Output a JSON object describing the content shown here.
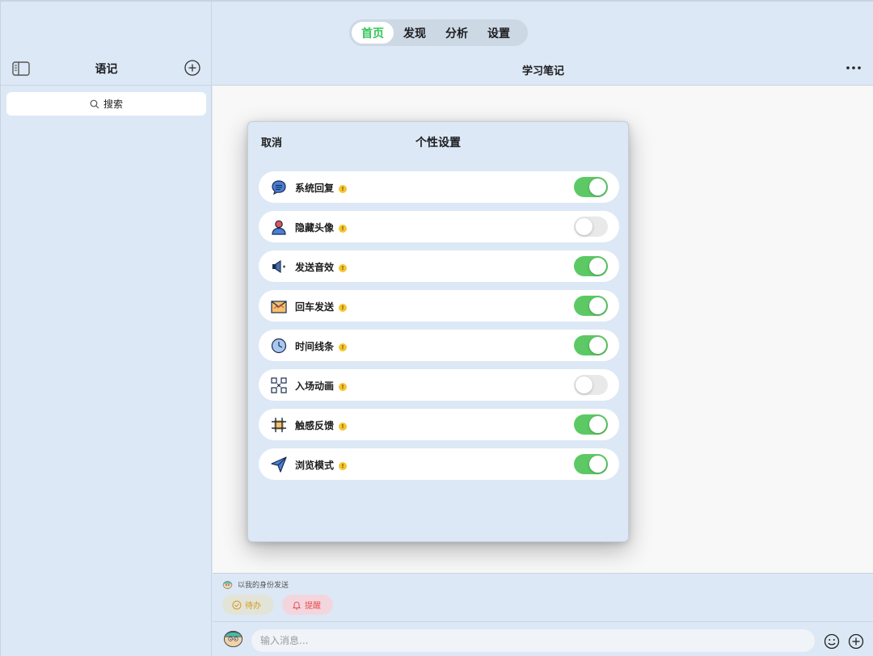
{
  "tabs": [
    {
      "label": "首页",
      "active": true
    },
    {
      "label": "发现",
      "active": false
    },
    {
      "label": "分析",
      "active": false
    },
    {
      "label": "设置",
      "active": false
    }
  ],
  "sidebar": {
    "title": "语记",
    "search_label": "搜索"
  },
  "main": {
    "title": "学习笔记"
  },
  "modal": {
    "cancel_label": "取消",
    "title": "个性设置",
    "info_glyph": "!",
    "settings": [
      {
        "label": "系统回复",
        "icon": "chat-bubble-icon",
        "enabled": true
      },
      {
        "label": "隐藏头像",
        "icon": "user-avatar-icon",
        "enabled": false
      },
      {
        "label": "发送音效",
        "icon": "speaker-icon",
        "enabled": true
      },
      {
        "label": "回车发送",
        "icon": "envelope-icon",
        "enabled": true
      },
      {
        "label": "时间线条",
        "icon": "clock-icon",
        "enabled": true
      },
      {
        "label": "入场动画",
        "icon": "expand-icon",
        "enabled": false
      },
      {
        "label": "触感反馈",
        "icon": "hashtag-icon",
        "enabled": true
      },
      {
        "label": "浏览模式",
        "icon": "paper-plane-icon",
        "enabled": true
      }
    ]
  },
  "composer": {
    "identity_label": "以我的身份发送",
    "chip_todo": "待办",
    "chip_remind": "提醒",
    "input_placeholder": "输入消息..."
  },
  "colors": {
    "accent_green": "#34c759",
    "toggle_on": "#5cc965",
    "toggle_off": "#e9e9ea",
    "background": "#dce8f5",
    "todo": "#d69a1e",
    "remind": "#e84e4e"
  }
}
